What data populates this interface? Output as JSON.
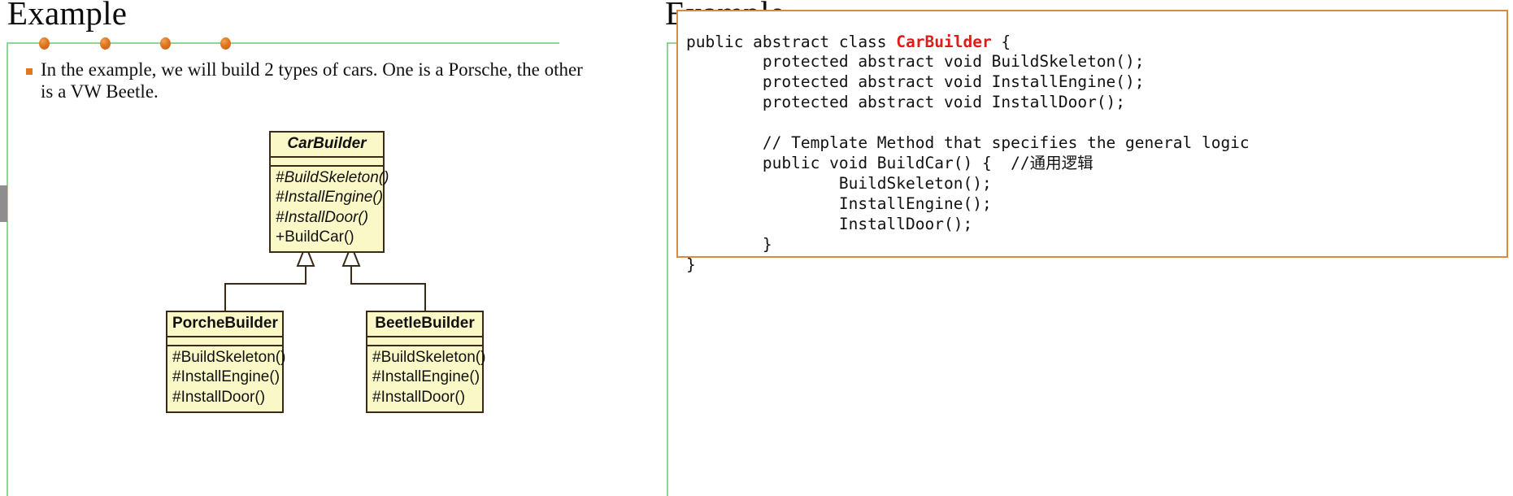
{
  "slides": [
    {
      "id": "left",
      "title": "Example",
      "bullet": "In the example, we will build 2 types of cars. One is a Porsche, the other is a VW Beetle.",
      "beads_x": [
        48,
        123,
        197,
        271
      ],
      "uml": {
        "base": {
          "name": "CarBuilder",
          "abstract": true,
          "operations": [
            {
              "text": "#BuildSkeleton()",
              "abstract": true
            },
            {
              "text": "#InstallEngine()",
              "abstract": true
            },
            {
              "text": "#InstallDoor()",
              "abstract": true
            },
            {
              "text": "+BuildCar()",
              "abstract": false
            }
          ]
        },
        "subclasses": [
          {
            "name": "PorcheBuilder",
            "abstract": false,
            "operations": [
              {
                "text": "#BuildSkeleton()",
                "abstract": false
              },
              {
                "text": "#InstallEngine()",
                "abstract": false
              },
              {
                "text": "#InstallDoor()",
                "abstract": false
              }
            ]
          },
          {
            "name": "BeetleBuilder",
            "abstract": false,
            "operations": [
              {
                "text": "#BuildSkeleton()",
                "abstract": false
              },
              {
                "text": "#InstallEngine()",
                "abstract": false
              },
              {
                "text": "#InstallDoor()",
                "abstract": false
              }
            ]
          }
        ]
      }
    },
    {
      "id": "right",
      "title": "Example",
      "beads_x": [
        52,
        125,
        200,
        274
      ],
      "code_lines": [
        {
          "indent": 0,
          "parts": [
            {
              "t": "public abstract class ",
              "k": "plain"
            },
            {
              "t": "CarBuilder",
              "k": "class"
            },
            {
              "t": " {",
              "k": "plain"
            }
          ]
        },
        {
          "indent": 1,
          "parts": [
            {
              "t": "protected abstract void BuildSkeleton();",
              "k": "plain"
            }
          ]
        },
        {
          "indent": 1,
          "parts": [
            {
              "t": "protected abstract void InstallEngine();",
              "k": "plain"
            }
          ]
        },
        {
          "indent": 1,
          "parts": [
            {
              "t": "protected abstract void InstallDoor();",
              "k": "plain"
            }
          ]
        },
        {
          "indent": 0,
          "parts": [
            {
              "t": "",
              "k": "plain"
            }
          ]
        },
        {
          "indent": 1,
          "parts": [
            {
              "t": "// Template Method that specifies the general logic",
              "k": "plain"
            }
          ]
        },
        {
          "indent": 1,
          "parts": [
            {
              "t": "public void BuildCar() {  //通用逻辑",
              "k": "plain"
            }
          ]
        },
        {
          "indent": 2,
          "parts": [
            {
              "t": "BuildSkeleton();",
              "k": "plain"
            }
          ]
        },
        {
          "indent": 2,
          "parts": [
            {
              "t": "InstallEngine();",
              "k": "plain"
            }
          ]
        },
        {
          "indent": 2,
          "parts": [
            {
              "t": "InstallDoor();",
              "k": "plain"
            }
          ]
        },
        {
          "indent": 1,
          "parts": [
            {
              "t": "}",
              "k": "plain"
            }
          ]
        },
        {
          "indent": 0,
          "parts": [
            {
              "t": "}",
              "k": "plain"
            }
          ]
        }
      ]
    }
  ],
  "colors": {
    "rule_green": "#8fd49a",
    "bead_orange": "#e07820",
    "code_border": "#d98b3d",
    "class_name_red": "#e01b1b",
    "uml_fill": "#fbf8c8",
    "uml_stroke": "#3a2a18"
  }
}
